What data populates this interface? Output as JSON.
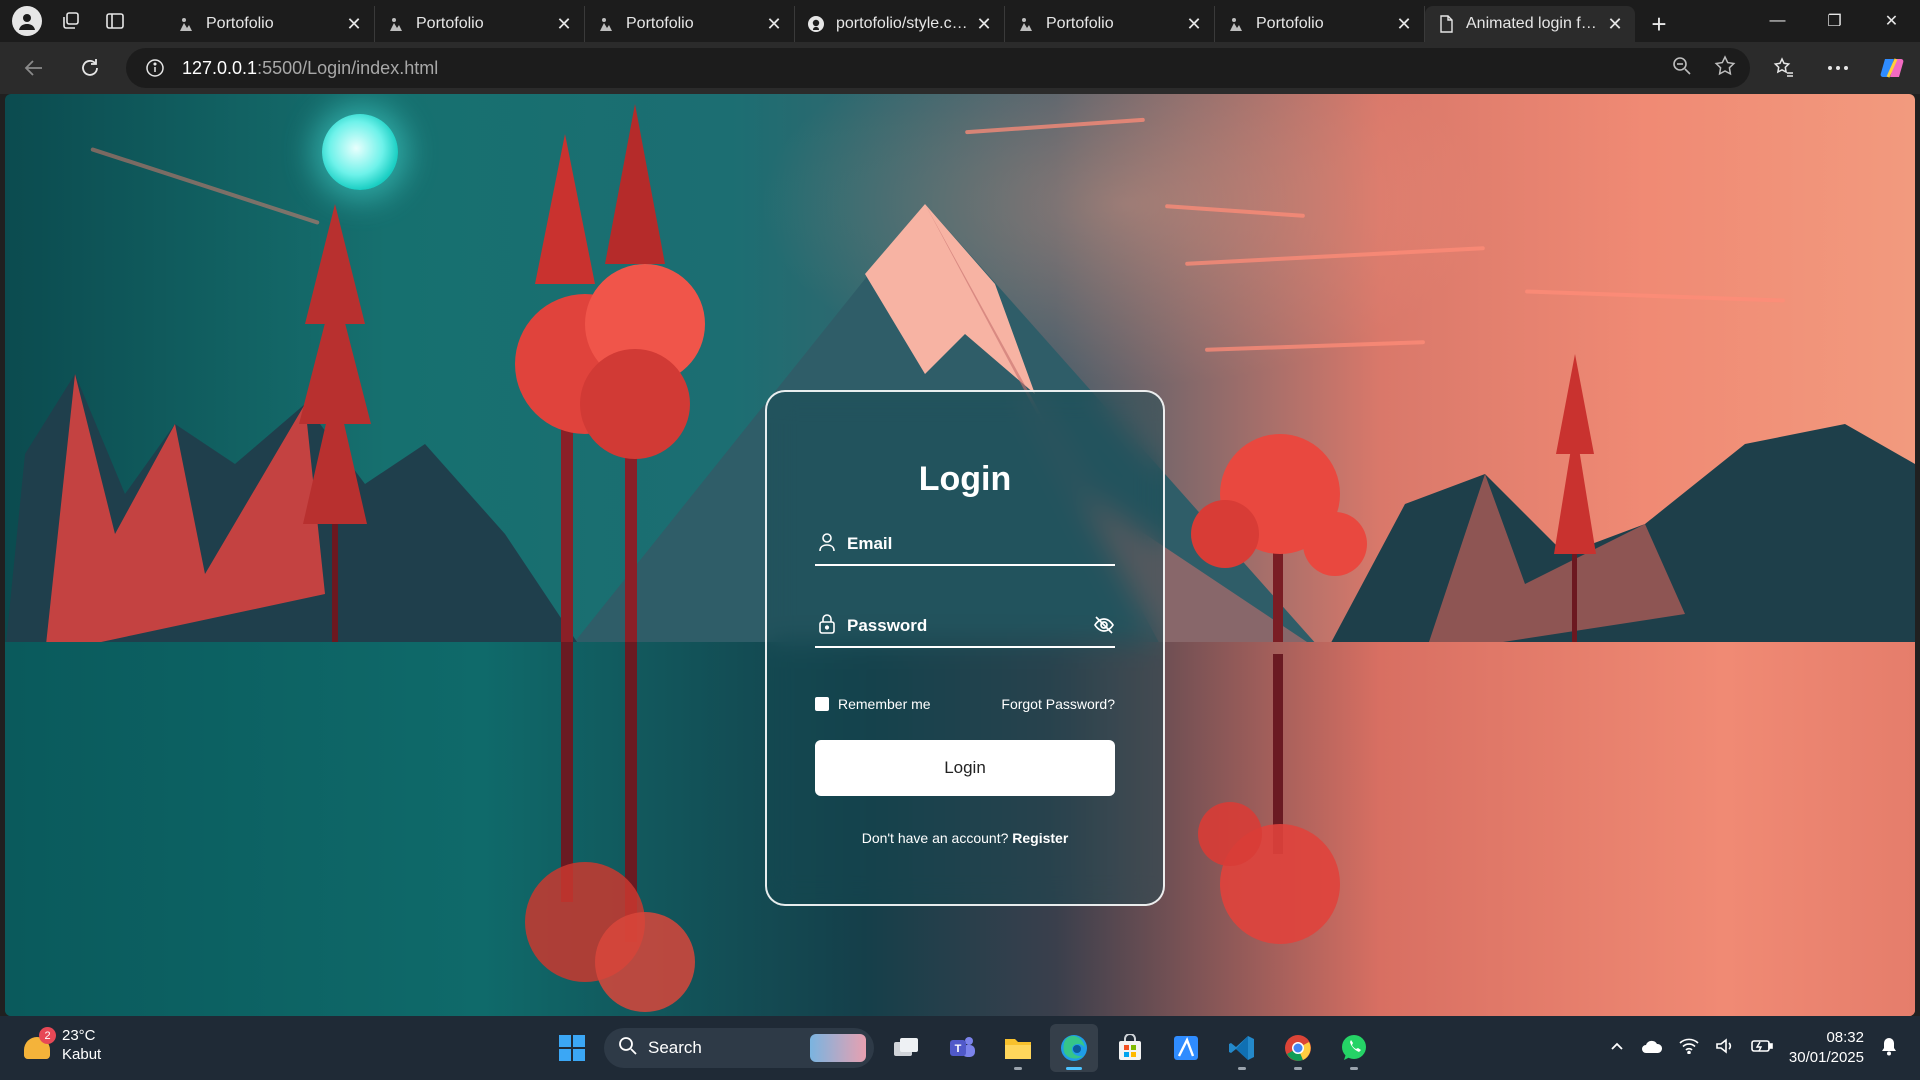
{
  "browser": {
    "tabs": [
      {
        "title": "Portofolio",
        "icon": "portfolio-favicon"
      },
      {
        "title": "Portofolio",
        "icon": "portfolio-favicon"
      },
      {
        "title": "Portofolio",
        "icon": "portfolio-favicon"
      },
      {
        "title": "portofolio/style.css a",
        "icon": "github-icon"
      },
      {
        "title": "Portofolio",
        "icon": "portfolio-favicon"
      },
      {
        "title": "Portofolio",
        "icon": "portfolio-favicon"
      },
      {
        "title": "Animated login form",
        "icon": "page-icon",
        "active": true
      }
    ],
    "url_host": "127.0.0.1",
    "url_path": ":5500/Login/index.html"
  },
  "login": {
    "title": "Login",
    "email_label": "Email",
    "password_label": "Password",
    "remember_label": "Remember me",
    "forgot_label": "Forgot Password?",
    "button_label": "Login",
    "register_prompt": "Don't have an account?",
    "register_link": "Register"
  },
  "taskbar": {
    "weather_temp": "23°C",
    "weather_desc": "Kabut",
    "weather_badge": "2",
    "search_placeholder": "Search",
    "time": "08:32",
    "date": "30/01/2025"
  },
  "colors": {
    "taskbar_bg": "#1f2a36",
    "chrome_bg": "#1c1c1c",
    "accent": "#4cc2ff"
  }
}
